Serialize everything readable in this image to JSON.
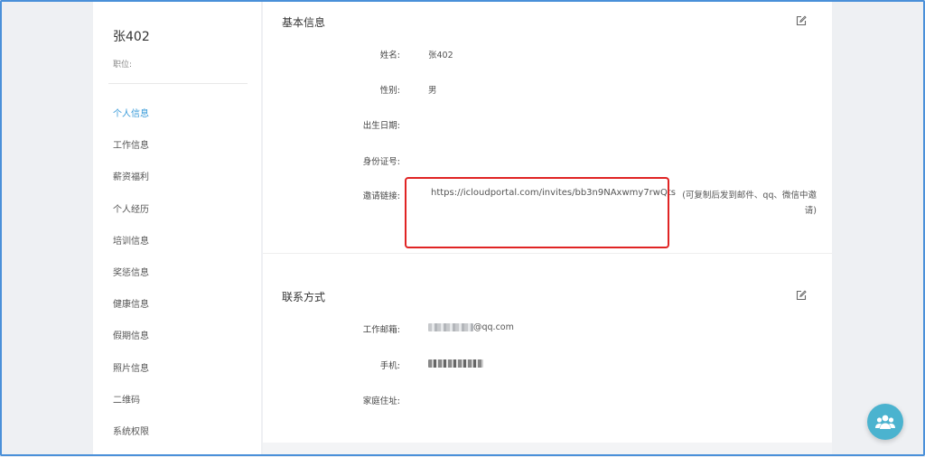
{
  "profile": {
    "name": "张402",
    "position_label": "职位:"
  },
  "sidebar": {
    "items": [
      {
        "label": "个人信息",
        "active": true
      },
      {
        "label": "工作信息",
        "active": false
      },
      {
        "label": "薪资福利",
        "active": false
      },
      {
        "label": "个人经历",
        "active": false
      },
      {
        "label": "培训信息",
        "active": false
      },
      {
        "label": "奖惩信息",
        "active": false
      },
      {
        "label": "健康信息",
        "active": false
      },
      {
        "label": "假期信息",
        "active": false
      },
      {
        "label": "照片信息",
        "active": false
      },
      {
        "label": "二维码",
        "active": false
      },
      {
        "label": "系统权限",
        "active": false
      }
    ]
  },
  "basic_info": {
    "title": "基本信息",
    "edit_icon": "edit-icon",
    "fields": {
      "name": {
        "label": "姓名:",
        "value": "张402"
      },
      "gender": {
        "label": "性别:",
        "value": "男"
      },
      "birthdate": {
        "label": "出生日期:",
        "value": ""
      },
      "id_number": {
        "label": "身份证号:",
        "value": ""
      },
      "invite": {
        "label": "邀请链接:",
        "value": "https://icloudportal.com/invites/bb3n9NAxwmy7rwQts",
        "hint": "(可复制后发到邮件、qq、微信中邀请)"
      }
    }
  },
  "contact_info": {
    "title": "联系方式",
    "edit_icon": "edit-icon",
    "fields": {
      "work_email": {
        "label": "工作邮箱:",
        "value_suffix": "@qq.com"
      },
      "mobile": {
        "label": "手机:",
        "value": ""
      },
      "home_address": {
        "label": "家庭住址:",
        "value": ""
      }
    }
  },
  "help_button": {
    "icon": "users-icon"
  },
  "colors": {
    "accent": "#3a9bd9",
    "highlight_box": "#e02424",
    "fab": "#4bb3cf",
    "frame": "#4a90d9"
  }
}
